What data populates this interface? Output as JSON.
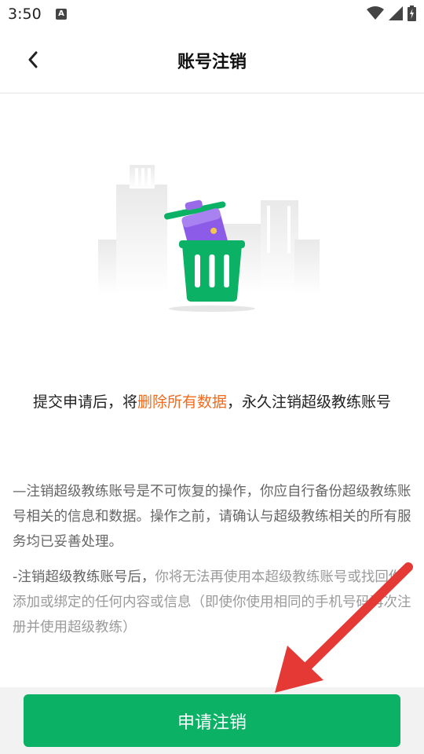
{
  "status_bar": {
    "time": "3:50",
    "icons": [
      "accessibility-a-icon",
      "wifi-icon",
      "cellular-signal-icon",
      "battery-charging-icon"
    ]
  },
  "header": {
    "back_icon": "chevron-left-icon",
    "title": "账号注销"
  },
  "illustration": {
    "icon": "trash-can-with-card-illustration",
    "accent_color": "#0bb266",
    "card_color": "#8c5be8"
  },
  "headline": {
    "prefix": "提交申请后，将",
    "highlight": "删除所有数据",
    "suffix": "，永久注销超级教练账号",
    "highlight_color": "#f26b1d"
  },
  "notices": {
    "first": "—注销超级教练账号是不可恢复的操作，你应自行备份超级教练账号相关的信息和数据。操作之前，请确认与超级教练相关的所有服务均已妥善处理。",
    "second_strong": "-注销超级教练账号后，",
    "second_light": "你将无法再使用本超级教练账号或找回你添加或绑定的任何内容或信息（即使你使用相同的手机号码再次注册并使用超级教练）"
  },
  "bottom": {
    "apply_label": "申请注销",
    "button_color": "#0bb266"
  },
  "annotation": {
    "arrow_color": "#e53935"
  }
}
